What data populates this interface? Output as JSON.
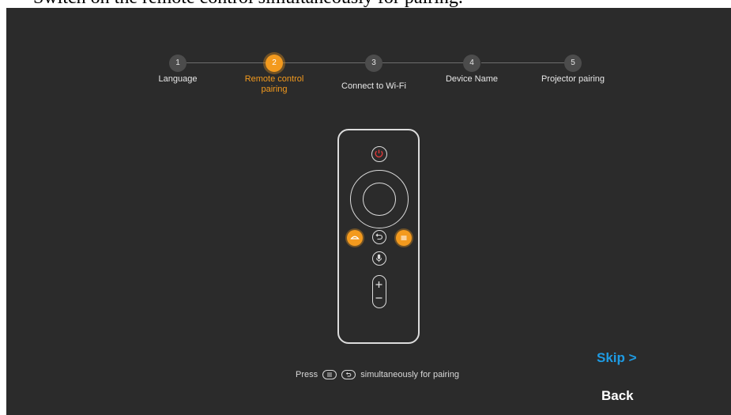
{
  "caption": "Switch on the remote control simultaneously for pairing.",
  "stepper": {
    "steps": [
      {
        "number": "1",
        "label": "Language"
      },
      {
        "number": "2",
        "label_line1": "Remote control",
        "label_line2": "pairing"
      },
      {
        "number": "3",
        "label": "Connect to Wi-Fi"
      },
      {
        "number": "4",
        "label": "Device Name"
      },
      {
        "number": "5",
        "label": "Projector pairing"
      }
    ],
    "active_step": 2
  },
  "hint": {
    "press": "Press",
    "suffix": "simultaneously for pairing"
  },
  "buttons": {
    "skip": "Skip >",
    "back": "Back"
  },
  "colors": {
    "background": "#2b2b2b",
    "accent": "#f39a1e",
    "link": "#1e9be3",
    "power": "#e03a3a"
  }
}
